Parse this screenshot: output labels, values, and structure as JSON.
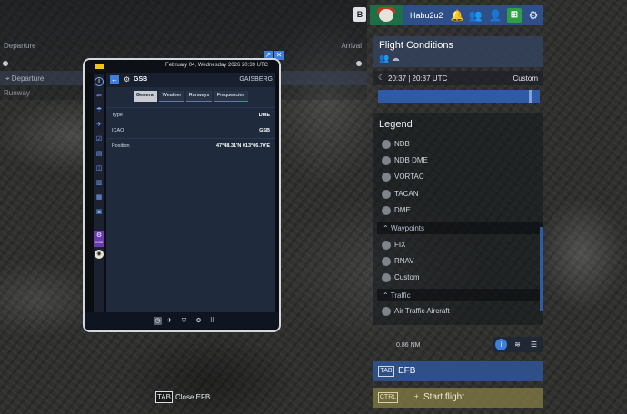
{
  "route": {
    "departure_label": "Departure",
    "arrival_label": "Arrival",
    "departure_item": "Departure",
    "runway_label": "Runway"
  },
  "header": {
    "b_key": "B",
    "username": "Habu2u2"
  },
  "flight_conditions": {
    "title": "Flight Conditions",
    "time": "20:37 | 20:37 UTC",
    "mode": "Custom"
  },
  "legend": {
    "title": "Legend",
    "items": [
      "NDB",
      "NDB DME",
      "VORTAC",
      "TACAN",
      "DME"
    ],
    "waypoints_section": "Waypoints",
    "waypoint_items": [
      "FIX",
      "RNAV",
      "Custom"
    ],
    "traffic_section": "Traffic",
    "traffic_items": [
      "Air Traffic Aircraft"
    ]
  },
  "map": {
    "scale": "0.86 NM"
  },
  "buttons": {
    "efb_key": "TAB",
    "efb_label": "EFB",
    "start_key": "CTRL",
    "start_plus": "+",
    "start_label": "Start flight",
    "close_key": "TAB",
    "close_label": "Close EFB"
  },
  "efb": {
    "date": "February 04, Wednesday 2026 20:39 UTC",
    "station_id": "GSB",
    "station_name": "GAISBERG",
    "rail_active_label": "GSB",
    "tabs": [
      "General",
      "Weather",
      "Runways",
      "Frequencies"
    ],
    "active_tab": "General",
    "rows": [
      {
        "key": "Type",
        "value": "DME"
      },
      {
        "key": "ICAO",
        "value": "GSB"
      },
      {
        "key": "Position",
        "value": "47°48.31'N   013°06.70'E"
      }
    ]
  },
  "colors": {
    "accent": "#3d7fdc",
    "profile_bar": "#2e4f88",
    "start_flight": "#847c46",
    "rail_active": "#6a3ab0",
    "battery": "#f0c419"
  }
}
